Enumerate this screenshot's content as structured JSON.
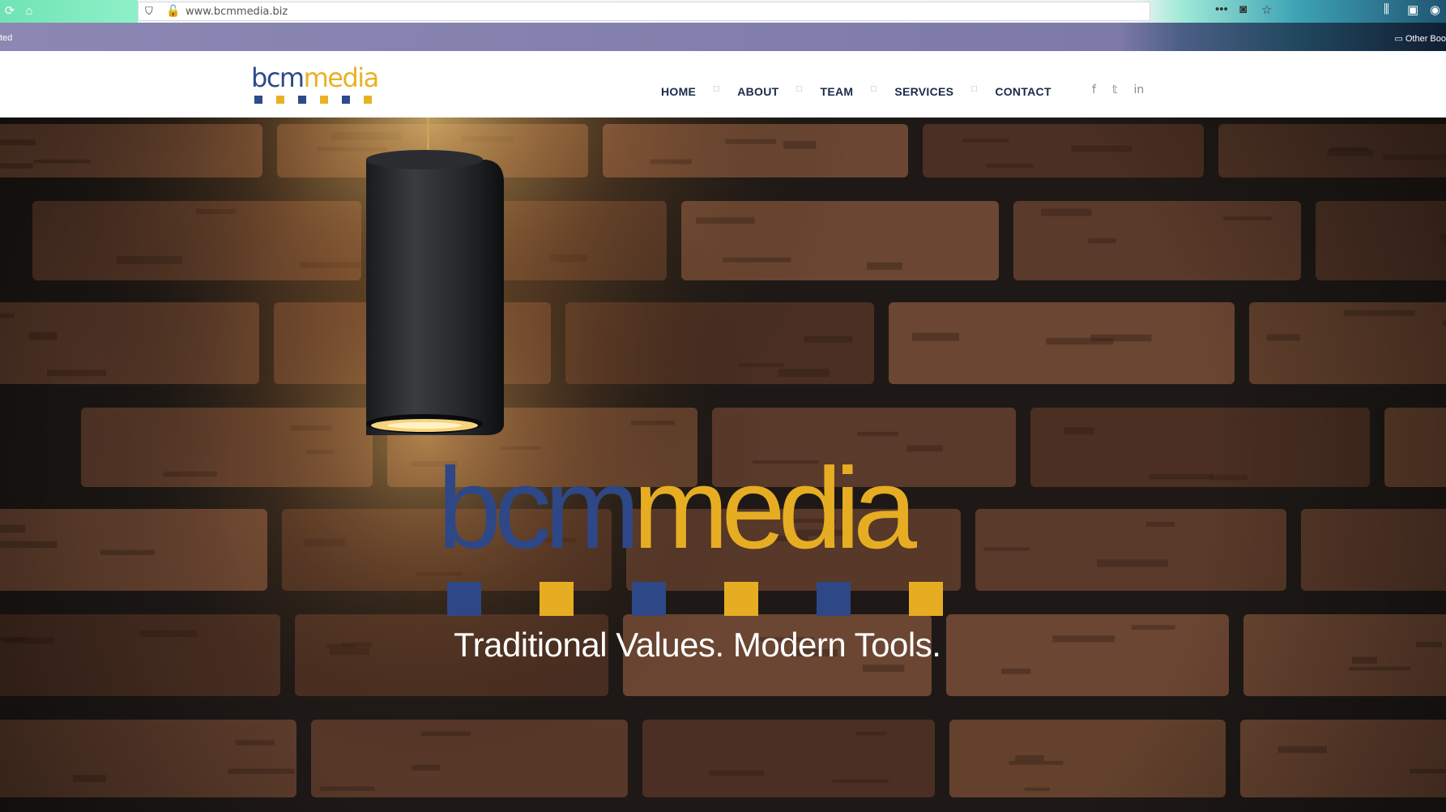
{
  "browser": {
    "url": "www.bcmmedia.biz",
    "bookmarks_left_fragment": "ted",
    "bookmarks_right": "Other Boo",
    "icons": [
      "reload-icon",
      "home-icon",
      "shield-icon",
      "insecure-lock-icon",
      "more-icon",
      "pocket-icon",
      "star-icon",
      "library-icon",
      "sidebar-icon",
      "account-icon"
    ]
  },
  "site": {
    "logo": {
      "bcm": "bcm",
      "media": "media"
    },
    "nav": [
      {
        "label": "HOME"
      },
      {
        "label": "ABOUT"
      },
      {
        "label": "TEAM"
      },
      {
        "label": "SERVICES"
      },
      {
        "label": "CONTACT"
      }
    ],
    "social": [
      {
        "name": "facebook-icon",
        "glyph": "f"
      },
      {
        "name": "twitter-icon",
        "glyph": "🐦"
      },
      {
        "name": "linkedin-icon",
        "glyph": "in"
      }
    ],
    "hero": {
      "bcm": "bcm",
      "media": "media",
      "tagline": "Traditional Values. Modern Tools."
    },
    "colors": {
      "blue": "#2e4786",
      "gold": "#e6ad23",
      "nav_text": "#1b2a4a"
    }
  }
}
